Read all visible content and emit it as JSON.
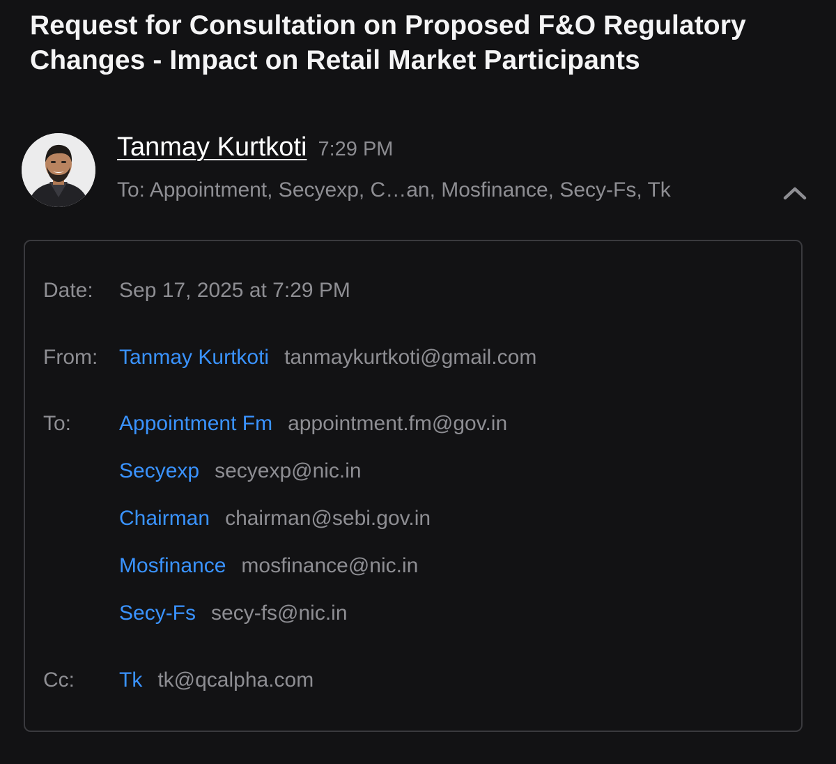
{
  "subject": "Request for Consultation on Proposed F&O Regulatory Changes - Impact on Retail Market Participants",
  "sender": {
    "name": "Tanmay Kurtkoti",
    "time": "7:29 PM",
    "to_summary": "To: Appointment, Secyexp, C…an, Mosfinance, Secy-Fs, Tk"
  },
  "details": {
    "date_label": "Date:",
    "date_value": "Sep 17, 2025 at 7:29 PM",
    "from_label": "From:",
    "from": {
      "name": "Tanmay Kurtkoti",
      "email": "tanmaykurtkoti@gmail.com"
    },
    "to_label": "To:",
    "to": [
      {
        "name": "Appointment Fm",
        "email": "appointment.fm@gov.in"
      },
      {
        "name": "Secyexp",
        "email": "secyexp@nic.in"
      },
      {
        "name": "Chairman",
        "email": "chairman@sebi.gov.in"
      },
      {
        "name": "Mosfinance",
        "email": "mosfinance@nic.in"
      },
      {
        "name": "Secy-Fs",
        "email": "secy-fs@nic.in"
      }
    ],
    "cc_label": "Cc:",
    "cc": [
      {
        "name": "Tk",
        "email": "tk@qcalpha.com"
      }
    ]
  },
  "colors": {
    "background": "#121214",
    "link": "#3a93ff",
    "secondary_text": "#8e8e93",
    "border": "#3a3a3e"
  },
  "icons": {
    "avatar": "sender-avatar-photo",
    "collapse": "chevron-up-icon"
  }
}
